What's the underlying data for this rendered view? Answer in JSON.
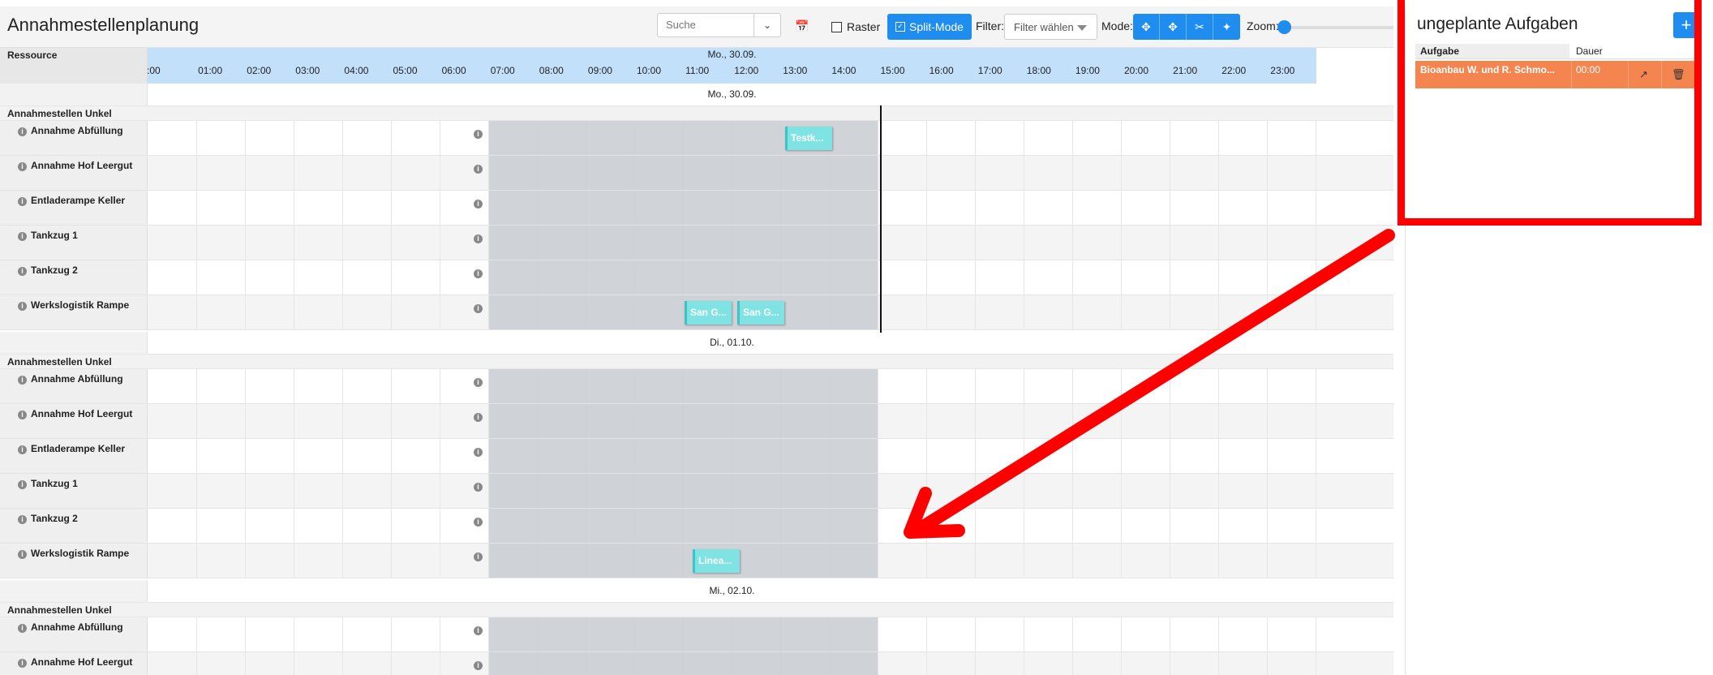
{
  "scheduler": {
    "title": "Annahmestellenplanung",
    "search_placeholder": "Suche",
    "raster_label": "Raster",
    "split_mode_label": "Split-Mode",
    "filter_label": "Filter:",
    "filter_value": "Filter wählen",
    "mode_label": "Mode:",
    "zoom_label": "Zoom:",
    "zoom_level": 0.0,
    "resource_header": "Ressource",
    "header_date": "Mo., 30.09.",
    "hours": [
      ":00",
      "01:00",
      "02:00",
      "03:00",
      "04:00",
      "05:00",
      "06:00",
      "07:00",
      "08:00",
      "09:00",
      "10:00",
      "11:00",
      "12:00",
      "13:00",
      "14:00",
      "15:00",
      "16:00",
      "17:00",
      "18:00",
      "19:00",
      "20:00",
      "21:00",
      "22:00",
      "23:00"
    ],
    "days": [
      {
        "date": "Mo., 30.09.",
        "group": "Annahmestellen Unkel",
        "resources": [
          "Annahme Abfüllung",
          "Annahme Hof Leergut",
          "Entladerampe Keller",
          "Tankzug 1",
          "Tankzug 2",
          "Werkslogistik Rampe"
        ]
      },
      {
        "date": "Di., 01.10.",
        "group": "Annahmestellen Unkel",
        "resources": [
          "Annahme Abfüllung",
          "Annahme Hof Leergut",
          "Entladerampe Keller",
          "Tankzug 1",
          "Tankzug 2",
          "Werkslogistik Rampe"
        ]
      },
      {
        "date": "Mi., 02.10.",
        "group": "Annahmestellen Unkel",
        "resources": [
          "Annahme Abfüllung",
          "Annahme Hof Leergut"
        ]
      }
    ],
    "tasks": [
      {
        "label": "Testk...",
        "day": 0,
        "resource": 0
      },
      {
        "label": "San G...",
        "day": 0,
        "resource": 5
      },
      {
        "label": "San G...",
        "day": 0,
        "resource": 5
      },
      {
        "label": "Linea...",
        "day": 1,
        "resource": 5
      }
    ]
  },
  "unplanned": {
    "title": "ungeplante Aufgaben",
    "add_icon": "plus-icon",
    "col_task": "Aufgabe",
    "col_duration": "Dauer",
    "items": [
      {
        "task": "Bioanbau W. und R. Schmo...",
        "duration": "00:00"
      }
    ]
  },
  "colors": {
    "accent": "#1f8cf0",
    "task": "#7fe3e3",
    "unplanned_task": "#f5854f",
    "annotation": "#ff0000",
    "header_blue": "#c3e0fb"
  }
}
